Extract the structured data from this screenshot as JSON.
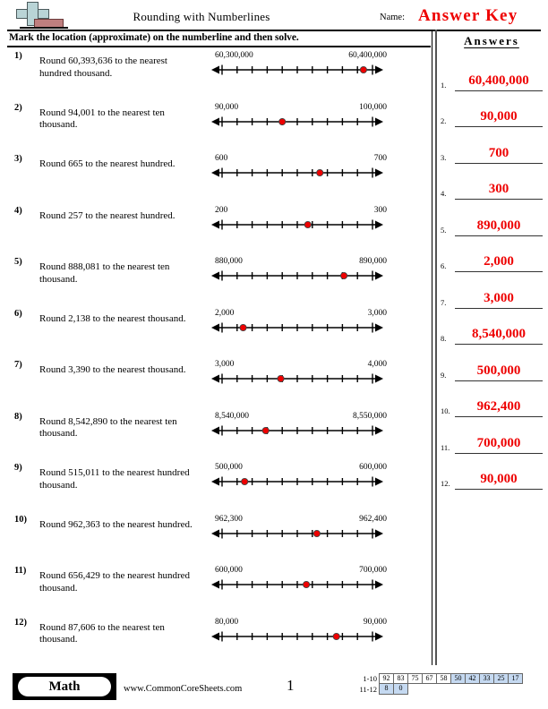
{
  "header": {
    "title": "Rounding with Numberlines",
    "name_label": "Name:",
    "answer_key": "Answer Key",
    "instructions": "Mark the location (approximate) on the numberline and then solve.",
    "logo_icon": "plus-block-logo"
  },
  "answers_panel": {
    "heading": "Answers",
    "items": [
      {
        "index": "1.",
        "value": "60,400,000"
      },
      {
        "index": "2.",
        "value": "90,000"
      },
      {
        "index": "3.",
        "value": "700"
      },
      {
        "index": "4.",
        "value": "300"
      },
      {
        "index": "5.",
        "value": "890,000"
      },
      {
        "index": "6.",
        "value": "2,000"
      },
      {
        "index": "7.",
        "value": "3,000"
      },
      {
        "index": "8.",
        "value": "8,540,000"
      },
      {
        "index": "9.",
        "value": "500,000"
      },
      {
        "index": "10.",
        "value": "962,400"
      },
      {
        "index": "11.",
        "value": "700,000"
      },
      {
        "index": "12.",
        "value": "90,000"
      }
    ]
  },
  "problems": [
    {
      "num": "1)",
      "text": "Round 60,393,636 to the nearest hundred thousand.",
      "left_label": "60,300,000",
      "right_label": "60,400,000",
      "dot_fraction": 0.94
    },
    {
      "num": "2)",
      "text": "Round 94,001 to the nearest ten thousand.",
      "left_label": "90,000",
      "right_label": "100,000",
      "dot_fraction": 0.4
    },
    {
      "num": "3)",
      "text": "Round 665 to the nearest hundred.",
      "left_label": "600",
      "right_label": "700",
      "dot_fraction": 0.65
    },
    {
      "num": "4)",
      "text": "Round 257 to the nearest hundred.",
      "left_label": "200",
      "right_label": "300",
      "dot_fraction": 0.57
    },
    {
      "num": "5)",
      "text": "Round 888,081 to the nearest ten thousand.",
      "left_label": "880,000",
      "right_label": "890,000",
      "dot_fraction": 0.81
    },
    {
      "num": "6)",
      "text": "Round 2,138 to the nearest thousand.",
      "left_label": "2,000",
      "right_label": "3,000",
      "dot_fraction": 0.14
    },
    {
      "num": "7)",
      "text": "Round 3,390 to the nearest thousand.",
      "left_label": "3,000",
      "right_label": "4,000",
      "dot_fraction": 0.39
    },
    {
      "num": "8)",
      "text": "Round 8,542,890 to the nearest ten thousand.",
      "left_label": "8,540,000",
      "right_label": "8,550,000",
      "dot_fraction": 0.29
    },
    {
      "num": "9)",
      "text": "Round 515,011 to the nearest hundred thousand.",
      "left_label": "500,000",
      "right_label": "600,000",
      "dot_fraction": 0.15
    },
    {
      "num": "10)",
      "text": "Round 962,363 to the nearest hundred.",
      "left_label": "962,300",
      "right_label": "962,400",
      "dot_fraction": 0.63
    },
    {
      "num": "11)",
      "text": "Round 656,429 to the nearest hundred thousand.",
      "left_label": "600,000",
      "right_label": "700,000",
      "dot_fraction": 0.56
    },
    {
      "num": "12)",
      "text": "Round 87,606 to the nearest ten thousand.",
      "left_label": "80,000",
      "right_label": "90,000",
      "dot_fraction": 0.76
    }
  ],
  "numberline": {
    "tick_count": 11,
    "dot_color": "#ee0000",
    "line_color": "#000000"
  },
  "footer": {
    "subject_badge": "Math",
    "site_url": "www.CommonCoreSheets.com",
    "page_number": "1",
    "scale": {
      "row1_label": "1-10",
      "row1_values": [
        "92",
        "83",
        "75",
        "67",
        "58",
        "50",
        "42",
        "33",
        "25",
        "17"
      ],
      "row1_highlight": [
        false,
        false,
        false,
        false,
        false,
        true,
        true,
        true,
        true,
        true
      ],
      "row2_label": "11-12",
      "row2_values": [
        "8",
        "0"
      ],
      "row2_highlight": [
        true,
        true
      ],
      "highlight_color": "#c5d9f1"
    }
  }
}
